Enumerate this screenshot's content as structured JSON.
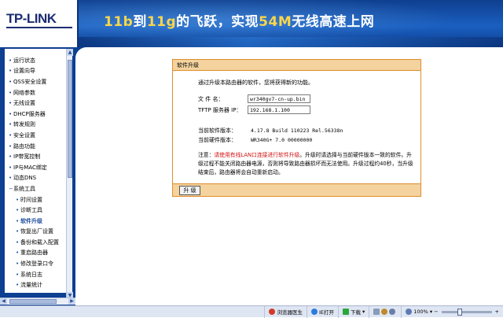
{
  "header": {
    "logo": "TP-LINK",
    "slogan_parts": [
      {
        "text": "11b",
        "style": "yel"
      },
      {
        "text": "到",
        "style": "w"
      },
      {
        "text": "11g",
        "style": "yel"
      },
      {
        "text": "的飞跃，实现",
        "style": "w"
      },
      {
        "text": "54M",
        "style": "yel"
      },
      {
        "text": "无线高速上网",
        "style": "w"
      }
    ]
  },
  "nav": {
    "items": [
      {
        "label": "运行状态",
        "sub": false
      },
      {
        "label": "设置向导",
        "sub": false
      },
      {
        "label": "QSS安全设置",
        "sub": false
      },
      {
        "label": "网络参数",
        "sub": false
      },
      {
        "label": "无线设置",
        "sub": false
      },
      {
        "label": "DHCP服务器",
        "sub": false
      },
      {
        "label": "转发规则",
        "sub": false
      },
      {
        "label": "安全设置",
        "sub": false
      },
      {
        "label": "路由功能",
        "sub": false
      },
      {
        "label": "IP带宽控制",
        "sub": false
      },
      {
        "label": "IP与MAC绑定",
        "sub": false
      },
      {
        "label": "动态DNS",
        "sub": false
      },
      {
        "label": "系统工具",
        "sub": false,
        "expanded": true
      },
      {
        "label": "时间设置",
        "sub": true
      },
      {
        "label": "诊断工具",
        "sub": true
      },
      {
        "label": "软件升级",
        "sub": true,
        "active": true
      },
      {
        "label": "恢复出厂设置",
        "sub": true
      },
      {
        "label": "备份和载入配置",
        "sub": true
      },
      {
        "label": "重启路由器",
        "sub": true
      },
      {
        "label": "修改登录口令",
        "sub": true
      },
      {
        "label": "系统日志",
        "sub": true
      },
      {
        "label": "流量统计",
        "sub": true
      }
    ]
  },
  "panel": {
    "title": "软件升级",
    "intro": "通过升级本路由器的软件，您将获得新的功能。",
    "filename_label": "文 件 名：",
    "filename_value": "wr340gv7-cn-up.bin",
    "tftp_label": "TFTP 服务器 IP：",
    "tftp_value": "192.168.1.100",
    "sw_label": "当前软件版本：",
    "sw_value": "4.17.8 Build 110223 Rel.56338n",
    "hw_label": "当前硬件版本：",
    "hw_value": "WR340G+ 7.0 00000000",
    "note_prefix": "注意：",
    "note_red": "请使用有线LAN口连接进行软件升级",
    "note_rest": "。升级时请选择与当前硬件版本一致的软件。升级过程不能关闭路由器电源，否则将导致路由器损坏而无法使用。升级过程约40秒，当升级结束后，路由器将会自动重新启动。",
    "upgrade_button": "升 级"
  },
  "statusbar": {
    "browser_doctor": "浏览器医生",
    "ie_open": "IE打开",
    "download": "下载",
    "zoom": "100%",
    "zoom_level": 0.35
  }
}
